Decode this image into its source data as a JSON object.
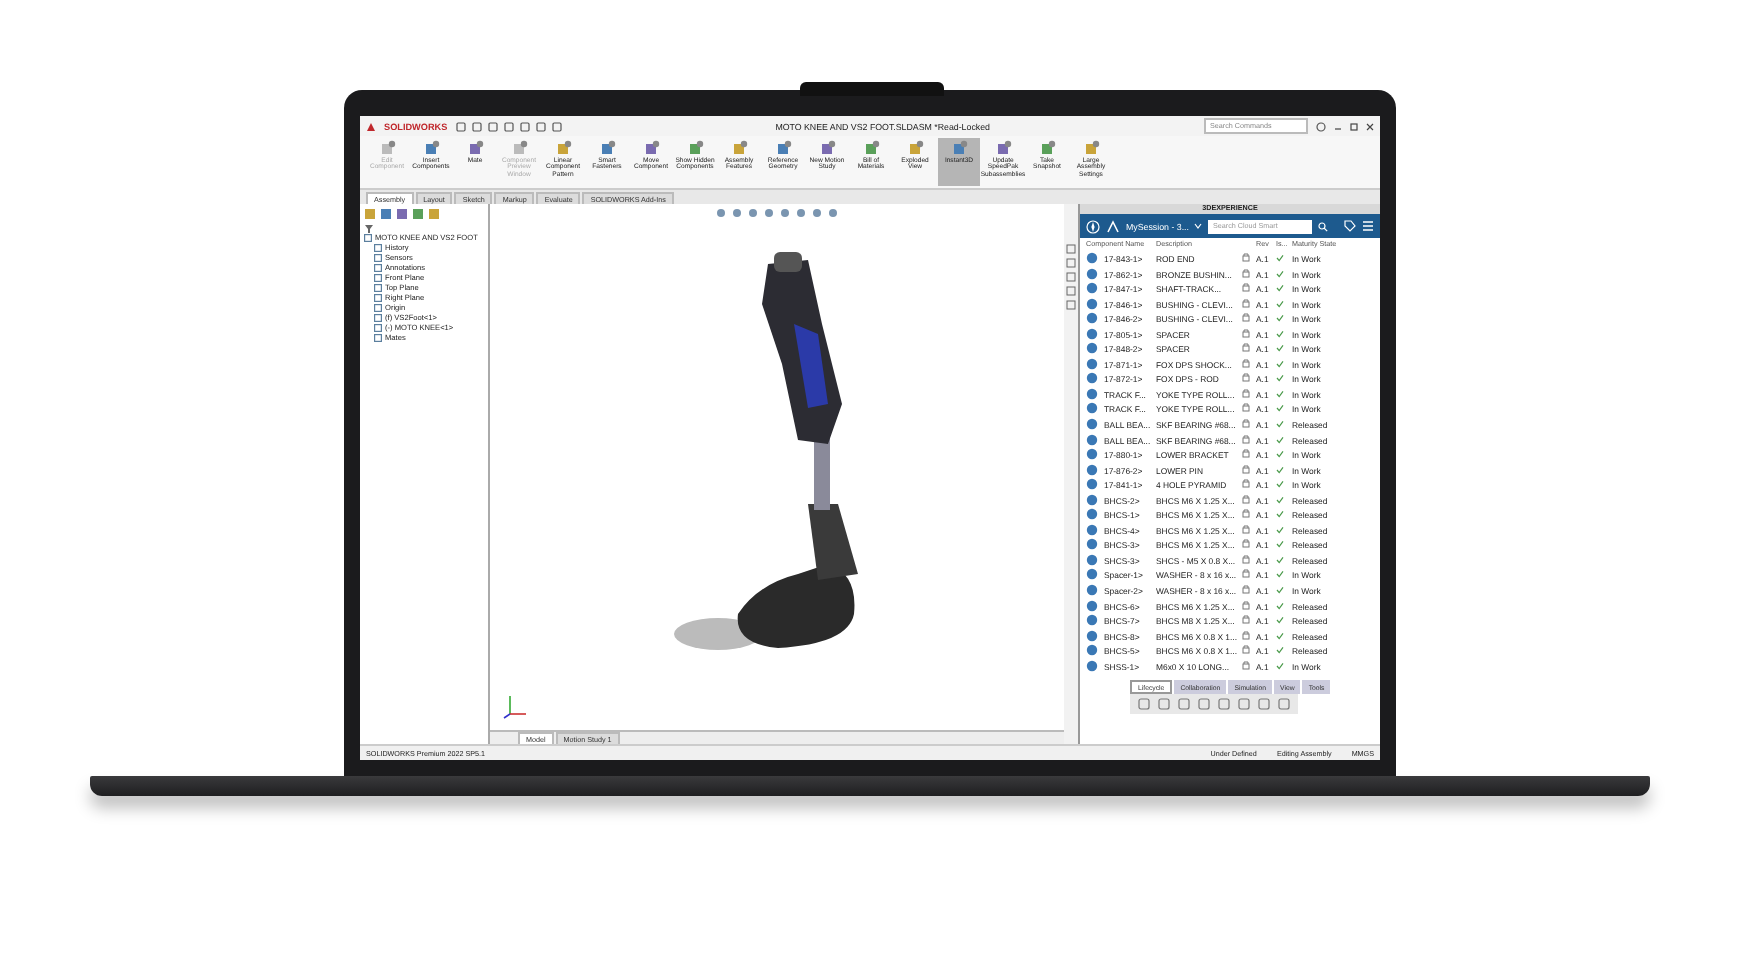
{
  "window": {
    "logo": "SOLIDWORKS",
    "title": "MOTO KNEE AND VS2 FOOT.SLDASM *Read-Locked",
    "search": {
      "placeholder": "Search Commands"
    }
  },
  "commands": [
    {
      "label": "Edit Component",
      "disabled": true,
      "selected": false
    },
    {
      "label": "Insert Components",
      "disabled": false,
      "selected": false
    },
    {
      "label": "Mate",
      "disabled": false,
      "selected": false
    },
    {
      "label": "Component Preview Window",
      "disabled": true,
      "selected": false
    },
    {
      "label": "Linear Component Pattern",
      "disabled": false,
      "selected": false
    },
    {
      "label": "Smart Fasteners",
      "disabled": false,
      "selected": false
    },
    {
      "label": "Move Component",
      "disabled": false,
      "selected": false
    },
    {
      "label": "Show Hidden Components",
      "disabled": false,
      "selected": false
    },
    {
      "label": "Assembly Features",
      "disabled": false,
      "selected": false
    },
    {
      "label": "Reference Geometry",
      "disabled": false,
      "selected": false
    },
    {
      "label": "New Motion Study",
      "disabled": false,
      "selected": false
    },
    {
      "label": "Bill of Materials",
      "disabled": false,
      "selected": false
    },
    {
      "label": "Exploded View",
      "disabled": false,
      "selected": false
    },
    {
      "label": "Instant3D",
      "disabled": false,
      "selected": true
    },
    {
      "label": "Update SpeedPak Subassemblies",
      "disabled": false,
      "selected": false
    },
    {
      "label": "Take Snapshot",
      "disabled": false,
      "selected": false
    },
    {
      "label": "Large Assembly Settings",
      "disabled": false,
      "selected": false
    }
  ],
  "tabs": [
    {
      "label": "Assembly",
      "selected": true
    },
    {
      "label": "Layout",
      "selected": false
    },
    {
      "label": "Sketch",
      "selected": false
    },
    {
      "label": "Markup",
      "selected": false
    },
    {
      "label": "Evaluate",
      "selected": false
    },
    {
      "label": "SOLIDWORKS Add-Ins",
      "selected": false
    }
  ],
  "tree": {
    "label": "MOTO KNEE AND VS2 FOOT",
    "children": [
      {
        "label": "History"
      },
      {
        "label": "Sensors"
      },
      {
        "label": "Annotations"
      },
      {
        "label": "Front Plane"
      },
      {
        "label": "Top Plane"
      },
      {
        "label": "Right Plane"
      },
      {
        "label": "Origin"
      },
      {
        "label": "(f) VS2Foot<1>"
      },
      {
        "label": "(-) MOTO KNEE<1>"
      },
      {
        "label": "Mates"
      }
    ]
  },
  "view_tabs": [
    {
      "label": "Model",
      "selected": true
    },
    {
      "label": "Motion Study 1",
      "selected": false
    }
  ],
  "panel": {
    "title": "3DEXPERIENCE",
    "session": "MySession - 3...",
    "search": {
      "placeholder": "Search Cloud Smart"
    },
    "columns": [
      "Component Name",
      "Description",
      "Rev",
      "Is...",
      "Maturity State"
    ],
    "rows": [
      {
        "name": "17-843-1>",
        "description": "ROD END",
        "rev": "A.1",
        "checked": true,
        "state": "In Work"
      },
      {
        "name": "17-862-1>",
        "description": "BRONZE BUSHIN...",
        "rev": "A.1",
        "checked": true,
        "state": "In Work"
      },
      {
        "name": "17-847-1>",
        "description": "SHAFT-TRACK...",
        "rev": "A.1",
        "checked": true,
        "state": "In Work"
      },
      {
        "name": "17-846-1>",
        "description": "BUSHING - CLEVI...",
        "rev": "A.1",
        "checked": true,
        "state": "In Work"
      },
      {
        "name": "17-846-2>",
        "description": "BUSHING - CLEVI...",
        "rev": "A.1",
        "checked": true,
        "state": "In Work"
      },
      {
        "name": "17-805-1>",
        "description": "SPACER",
        "rev": "A.1",
        "checked": true,
        "state": "In Work"
      },
      {
        "name": "17-848-2>",
        "description": "SPACER",
        "rev": "A.1",
        "checked": true,
        "state": "In Work"
      },
      {
        "name": "17-871-1>",
        "description": "FOX DPS SHOCK...",
        "rev": "A.1",
        "checked": true,
        "state": "In Work"
      },
      {
        "name": "17-872-1>",
        "description": "FOX DPS - ROD",
        "rev": "A.1",
        "checked": true,
        "state": "In Work"
      },
      {
        "name": "TRACK F...",
        "description": "YOKE TYPE ROLL...",
        "rev": "A.1",
        "checked": true,
        "state": "In Work"
      },
      {
        "name": "TRACK F...",
        "description": "YOKE TYPE ROLL...",
        "rev": "A.1",
        "checked": true,
        "state": "In Work"
      },
      {
        "name": "BALL BEA...",
        "description": "SKF BEARING #68...",
        "rev": "A.1",
        "checked": true,
        "state": "Released"
      },
      {
        "name": "BALL BEA...",
        "description": "SKF BEARING #68...",
        "rev": "A.1",
        "checked": true,
        "state": "Released"
      },
      {
        "name": "17-880-1>",
        "description": "LOWER BRACKET",
        "rev": "A.1",
        "checked": true,
        "state": "In Work"
      },
      {
        "name": "17-876-2>",
        "description": "LOWER PIN",
        "rev": "A.1",
        "checked": true,
        "state": "In Work"
      },
      {
        "name": "17-841-1>",
        "description": "4 HOLE PYRAMID",
        "rev": "A.1",
        "checked": true,
        "state": "In Work"
      },
      {
        "name": "BHCS-2>",
        "description": "BHCS M6 X 1.25 X...",
        "rev": "A.1",
        "checked": true,
        "state": "Released"
      },
      {
        "name": "BHCS-1>",
        "description": "BHCS M6 X 1.25 X...",
        "rev": "A.1",
        "checked": true,
        "state": "Released"
      },
      {
        "name": "BHCS-4>",
        "description": "BHCS M6 X 1.25 X...",
        "rev": "A.1",
        "checked": true,
        "state": "Released"
      },
      {
        "name": "BHCS-3>",
        "description": "BHCS M6 X 1.25 X...",
        "rev": "A.1",
        "checked": true,
        "state": "Released"
      },
      {
        "name": "SHCS-3>",
        "description": "SHCS - M5 X 0.8 X...",
        "rev": "A.1",
        "checked": true,
        "state": "Released"
      },
      {
        "name": "Spacer-1>",
        "description": "WASHER - 8 x 16 x...",
        "rev": "A.1",
        "checked": true,
        "state": "In Work"
      },
      {
        "name": "Spacer-2>",
        "description": "WASHER - 8 x 16 x...",
        "rev": "A.1",
        "checked": true,
        "state": "In Work"
      },
      {
        "name": "BHCS-6>",
        "description": "BHCS M6 X 1.25 X...",
        "rev": "A.1",
        "checked": true,
        "state": "Released"
      },
      {
        "name": "BHCS-7>",
        "description": "BHCS M8 X 1.25 X...",
        "rev": "A.1",
        "checked": true,
        "state": "Released"
      },
      {
        "name": "BHCS-8>",
        "description": "BHCS M6 X 0.8 X 1...",
        "rev": "A.1",
        "checked": true,
        "state": "Released"
      },
      {
        "name": "BHCS-5>",
        "description": "BHCS M6 X 0.8 X 1...",
        "rev": "A.1",
        "checked": true,
        "state": "Released"
      },
      {
        "name": "SHSS-1>",
        "description": "M6x0 X 10 LONG...",
        "rev": "A.1",
        "checked": true,
        "state": "In Work"
      }
    ],
    "tabs": [
      {
        "label": "Lifecycle",
        "selected": true
      },
      {
        "label": "Collaboration",
        "selected": false
      },
      {
        "label": "Simulation",
        "selected": false
      },
      {
        "label": "View",
        "selected": false
      },
      {
        "label": "Tools",
        "selected": false
      }
    ]
  },
  "status_bar": {
    "product": "SOLIDWORKS Premium 2022 SP5.1",
    "items": [
      "Under Defined",
      "Editing Assembly",
      "MMGS"
    ]
  }
}
